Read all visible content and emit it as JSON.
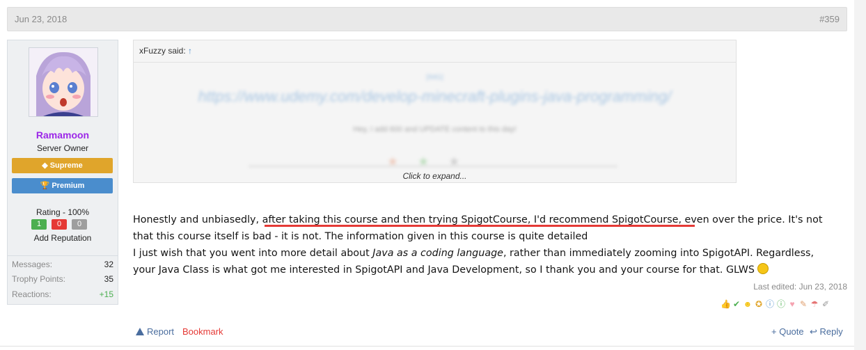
{
  "post": {
    "date": "Jun 23, 2018",
    "number": "#359"
  },
  "user": {
    "name": "Ramamoon",
    "title": "Server Owner",
    "banners": {
      "supreme": "Supreme",
      "premium": "Premium"
    },
    "rating_label": "Rating - 100%",
    "rep_positive": "1",
    "rep_negative": "0",
    "rep_neutral": "0",
    "add_rep": "Add Reputation",
    "stats": {
      "messages_label": "Messages:",
      "messages_value": "32",
      "trophy_label": "Trophy Points:",
      "trophy_value": "35",
      "reactions_label": "Reactions:",
      "reactions_value": "+15"
    }
  },
  "quote": {
    "author": "xFuzzy said:",
    "arrow": "↑",
    "blurred_tag": "[IMG]",
    "blurred_link": "https://www.udemy.com/develop-minecraft-plugins-java-programming/",
    "blurred_text": "Hey, I add 600 and UPDATE content to this day!",
    "expand": "Click to expand..."
  },
  "message": {
    "line1_a": "Honestly and unbiasedly, ",
    "line1_b": "after taking this course and then trying SpigotCourse, I'd recommend SpigotCourse",
    "line1_c": ", even over the price. It's not",
    "line2": "that this course itself is bad - it is not. The information given in this course is quite detailed",
    "line3_a": "I just wish that you went into more detail about ",
    "line3_em": "Java as a coding language",
    "line3_b": ", rather than immediately zooming into SpigotAPI. Regardless,",
    "line4": "your Java Class is what got me interested in SpigotAPI and Java Development, so I thank you and your course for that. GLWS "
  },
  "last_edited": "Last edited: Jun 23, 2018",
  "actions": {
    "report": "Report",
    "bookmark": "Bookmark",
    "quote": "+ Quote",
    "reply": "Reply"
  },
  "colors": {
    "username": "#9c27e8",
    "supreme": "#e0a52b",
    "premium": "#4a8dcd",
    "underline": "#e53935"
  }
}
